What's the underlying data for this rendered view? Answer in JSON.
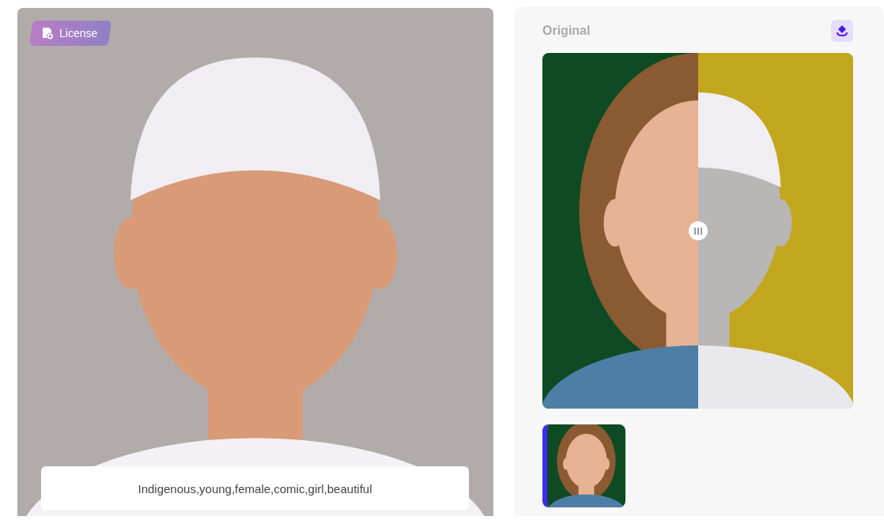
{
  "preview": {
    "badge": "License",
    "prompt": "Indigenous,young,female,comic,girl,beautiful"
  },
  "compare": {
    "title": "Original",
    "level": 0.5
  },
  "thumbnails": [
    {
      "selected": true
    }
  ]
}
